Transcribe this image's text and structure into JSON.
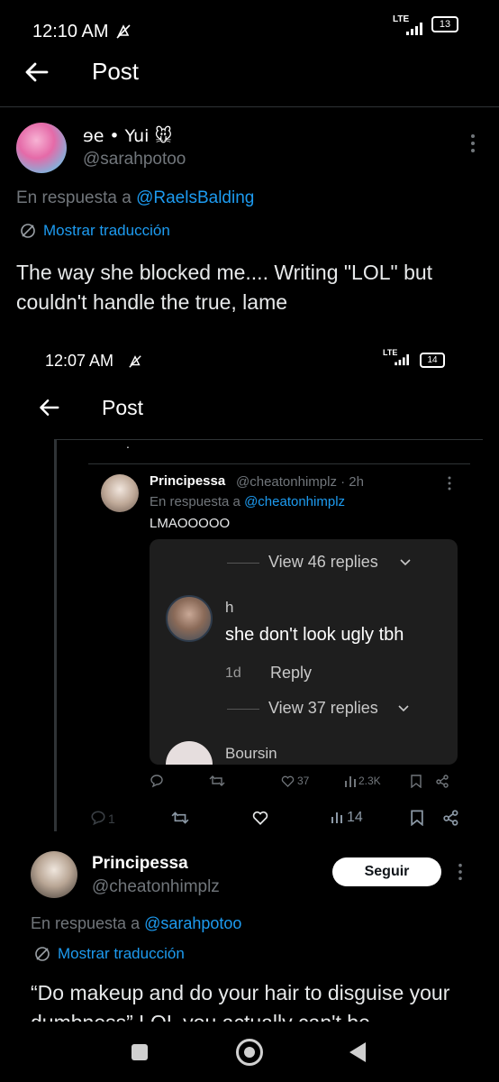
{
  "status_bar": {
    "time": "12:10 AM",
    "network": "LTE",
    "battery": "13"
  },
  "header": {
    "title": "Post"
  },
  "tweet": {
    "display_name": "ɘe • Yui 🐭",
    "handle": "@sarahpotoo",
    "reply_prefix": "En respuesta a",
    "reply_to": "@RaelsBalding",
    "translate": "Mostrar traducción",
    "text": "The way she blocked me.... Writing \"LOL\" but couldn't handle the true, lame"
  },
  "screenshot": {
    "status_time": "12:07 AM",
    "network": "LTE",
    "battery": "14",
    "header_title": "Post",
    "dot": ".",
    "nested": {
      "name": "Principessa",
      "handle_time": "@cheatonhimplz · 2h",
      "reply_prefix": "En respuesta a",
      "reply_to": "@cheatonhimplz",
      "text": "LMAOOOOO",
      "embed": {
        "view1": "View 46 replies",
        "comment_user": "h",
        "comment_text": "she don't look ugly tbh",
        "comment_age": "1d",
        "reply_label": "Reply",
        "view2": "View 37 replies",
        "next_user": "Boursin"
      },
      "actions": {
        "likes": "37",
        "views": "2.3K"
      }
    },
    "outer_actions": {
      "replies": "1",
      "views": "14"
    }
  },
  "reply_tweet": {
    "display_name": "Principessa",
    "handle": "@cheatonhimplz",
    "follow_label": "Seguir",
    "reply_prefix": "En respuesta a",
    "reply_to": "@sarahpotoo",
    "translate": "Mostrar traducción",
    "text": "“Do makeup and do your hair to disguise your dumbness” LOL you actually can't be"
  },
  "nav_bar": {
    "buttons": [
      "recents",
      "home",
      "back"
    ]
  }
}
